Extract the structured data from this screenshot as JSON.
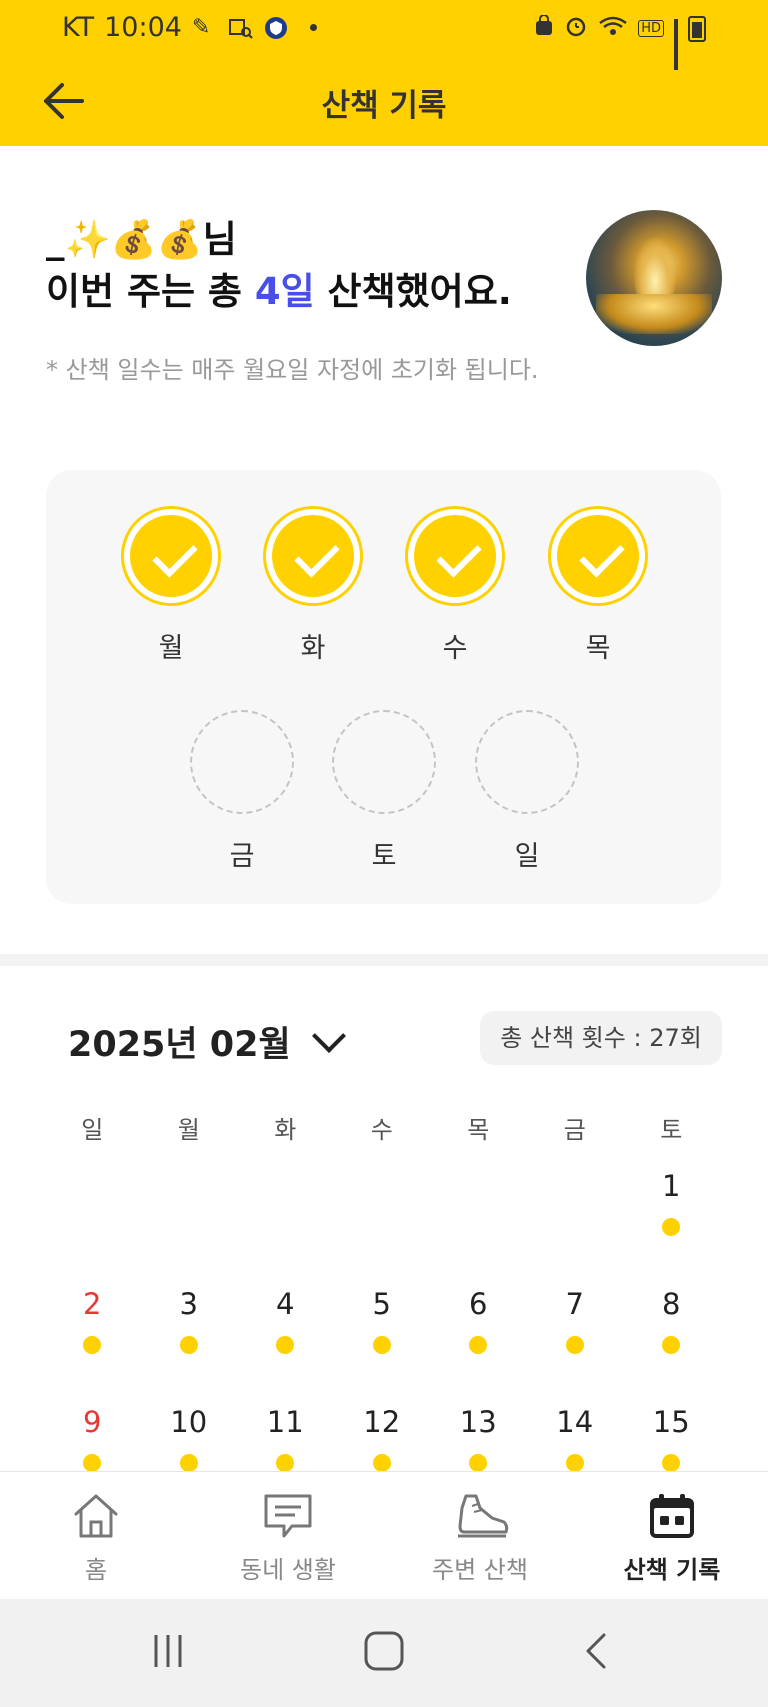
{
  "status_bar": {
    "carrier": "KT",
    "time": "10:04",
    "icons": [
      "pencil-icon",
      "chart-search-icon",
      "shield-app-icon",
      "notification-dot"
    ],
    "right_icons": [
      "vpn-icon",
      "alarm-icon",
      "wifi-icon",
      "hd-icon",
      "signal-icon",
      "battery-icon"
    ],
    "hd": "HD"
  },
  "appbar": {
    "title": "산책 기록",
    "back_icon": "arrow-left-icon"
  },
  "header": {
    "user_name": "_✨💰💰님",
    "summary_prefix": "이번 주는 총 ",
    "summary_count": "4일",
    "summary_suffix": " 산책했어요.",
    "note": "* 산책 일수는 매주 월요일 자정에 초기화 됩니다."
  },
  "week": {
    "days": [
      {
        "label": "월",
        "done": true
      },
      {
        "label": "화",
        "done": true
      },
      {
        "label": "수",
        "done": true
      },
      {
        "label": "목",
        "done": true
      },
      {
        "label": "금",
        "done": false
      },
      {
        "label": "토",
        "done": false
      },
      {
        "label": "일",
        "done": false
      }
    ]
  },
  "calendar": {
    "month_label": "2025년 02월",
    "total_label": "총 산책 횟수 : 27회",
    "weekdays": [
      "일",
      "월",
      "화",
      "수",
      "목",
      "금",
      "토"
    ],
    "rows": [
      [
        "",
        "",
        "",
        "",
        "",
        "",
        "1"
      ],
      [
        "2",
        "3",
        "4",
        "5",
        "6",
        "7",
        "8"
      ],
      [
        "9",
        "10",
        "11",
        "12",
        "13",
        "14",
        "15"
      ]
    ]
  },
  "bottom_nav": {
    "items": [
      {
        "label": "홈",
        "icon": "home-icon"
      },
      {
        "label": "동네 생활",
        "icon": "chat-icon"
      },
      {
        "label": "주변 산책",
        "icon": "shoe-icon"
      },
      {
        "label": "산책 기록",
        "icon": "calendar-icon",
        "active": true
      }
    ]
  },
  "colors": {
    "accent": "#FFD100",
    "highlight": "#4a4ee8",
    "sunday": "#e53935"
  }
}
